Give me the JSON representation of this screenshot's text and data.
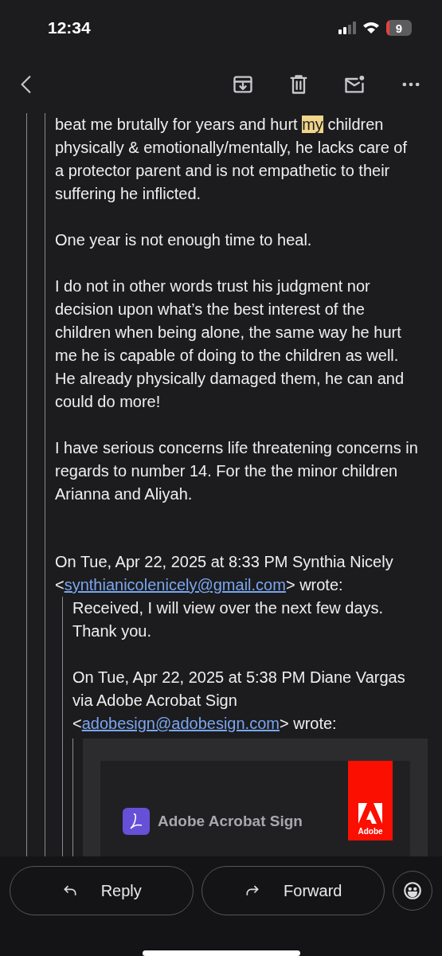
{
  "status_bar": {
    "time": "12:34",
    "battery": "9"
  },
  "message": {
    "paragraphs": [
      {
        "parts": [
          {
            "text": "beat me brutally for years and hurt ",
            "highlighted": false
          },
          {
            "text": "my",
            "highlighted": true
          },
          {
            "text": " children physically & emotionally/mentally, he lacks care of a protector parent and is not empathetic to their suffering he inflicted.",
            "highlighted": false
          }
        ]
      },
      {
        "parts": [
          {
            "text": "One year is not enough time to heal.",
            "highlighted": false
          }
        ]
      },
      {
        "parts": [
          {
            "text": "I do not in other words trust his judgment nor decision upon what’s the best interest of the children when being alone, the same way he hurt me he is capable of doing to the children as well. He already physically damaged them, he can and could do more!",
            "highlighted": false
          }
        ]
      },
      {
        "parts": [
          {
            "text": "I have serious concerns life threatening concerns in regards to number 14. For the the minor children Arianna and Aliyah.",
            "highlighted": false
          }
        ]
      }
    ],
    "quote": {
      "attribution": {
        "before": "On Tue, Apr 22, 2025 at 8:33 PM Synthia Nicely <",
        "link": "synthianicolenicely@gmail.com",
        "after": "> wrote:"
      },
      "paragraphs": [
        "Received, I will view over the next few days. Thank you."
      ],
      "quote": {
        "attribution": {
          "before": "On Tue, Apr 22, 2025 at 5:38 PM Diane Vargas via Adobe Acrobat Sign <",
          "link": "adobesign@adobesign.com",
          "after": "> wrote:"
        },
        "card": {
          "brand": "Adobe Acrobat Sign",
          "logo_text": "Adobe"
        }
      }
    }
  },
  "actions": [
    {
      "kind": "reply",
      "label": "Reply"
    },
    {
      "kind": "forward",
      "label": "Forward"
    }
  ]
}
